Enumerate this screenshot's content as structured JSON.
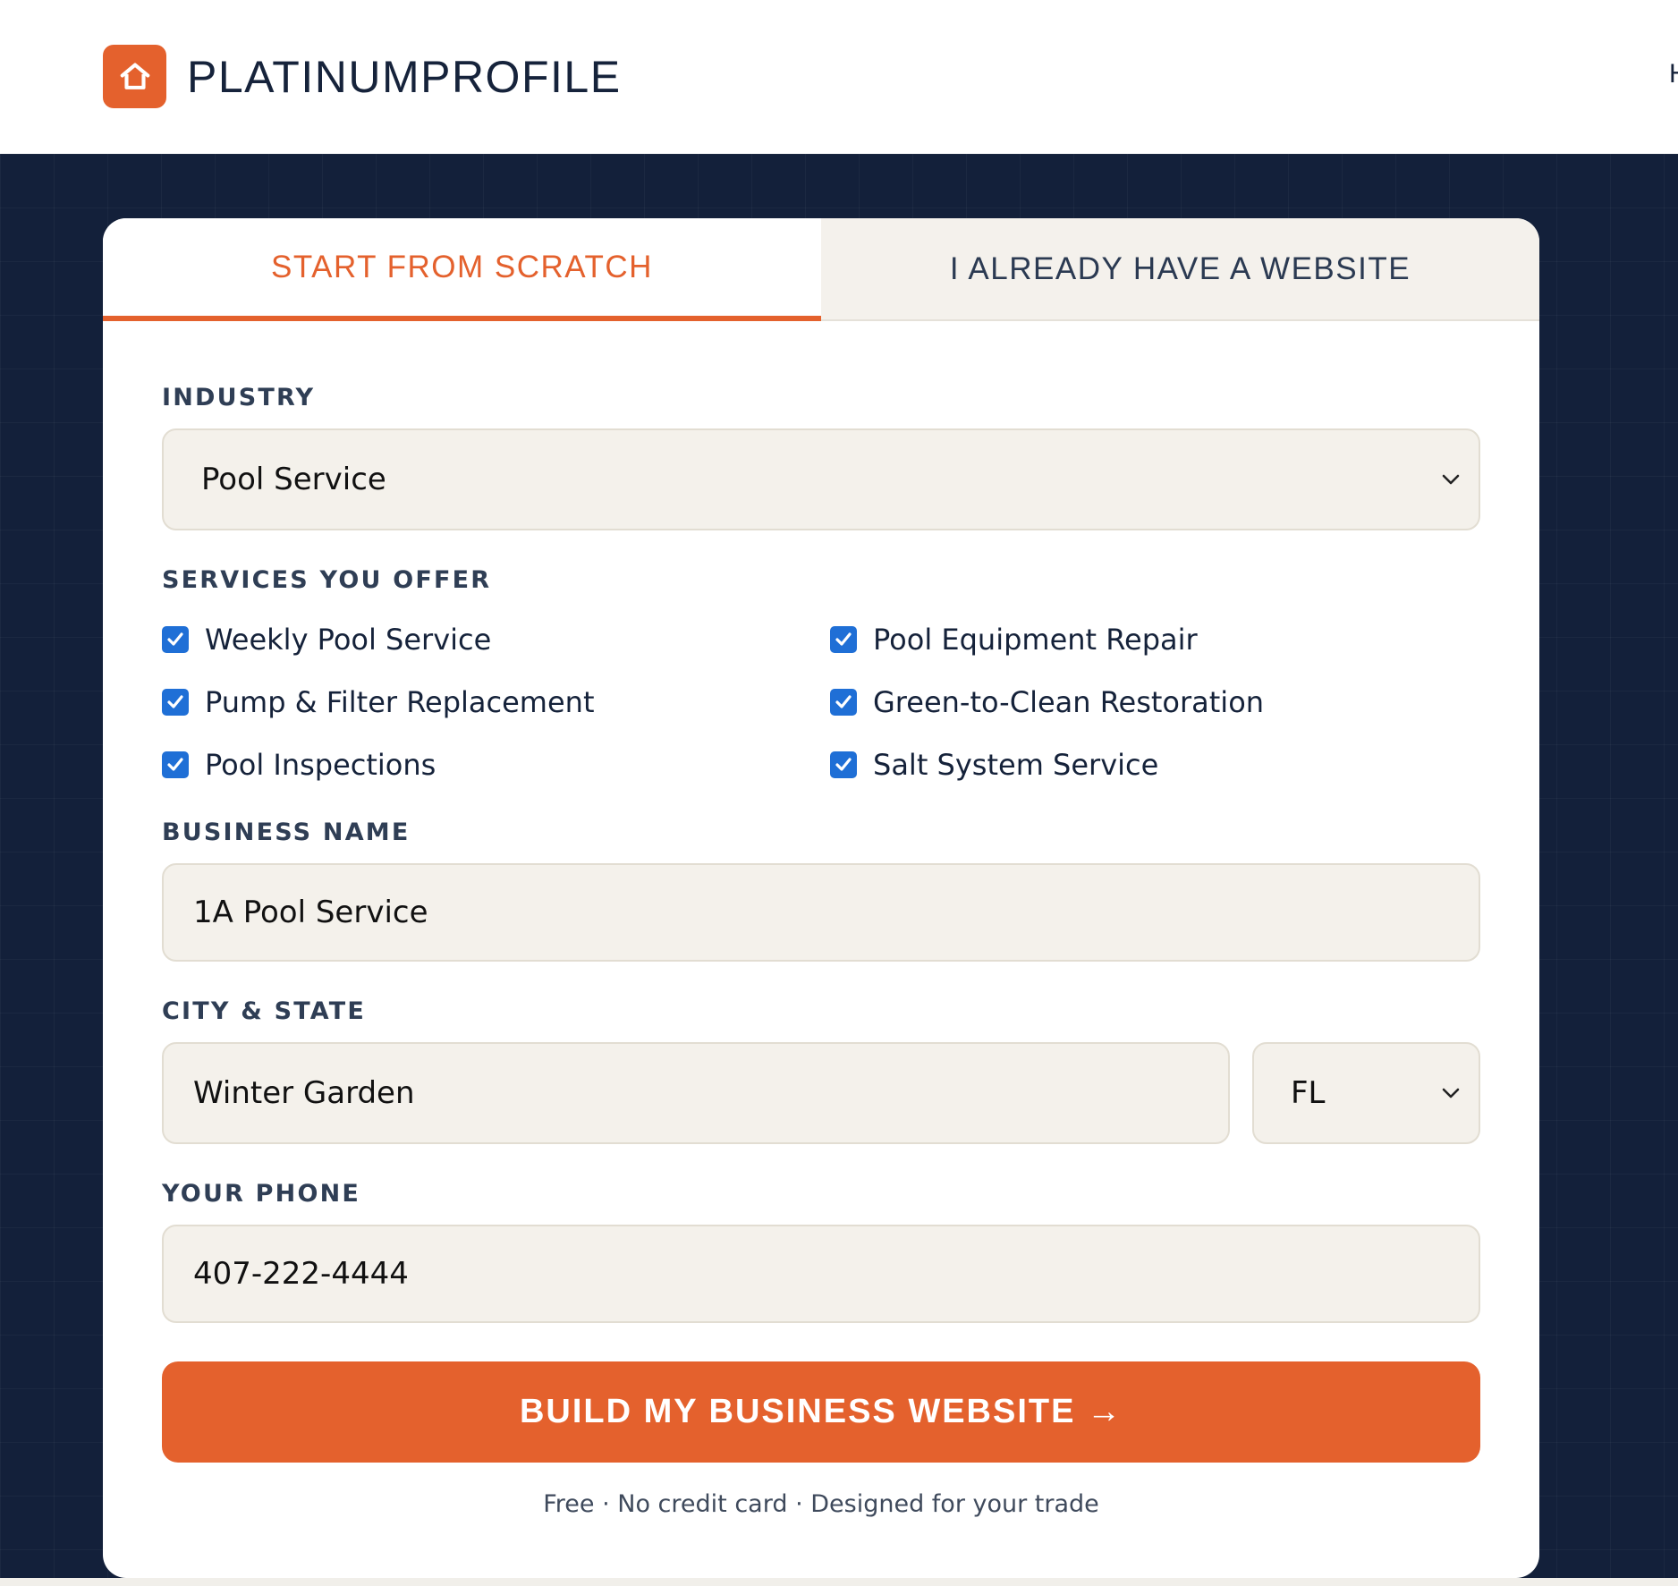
{
  "header": {
    "brand": "PLATINUMPROFILE",
    "logo_icon": "home-icon",
    "nav_peek": "H"
  },
  "tabs": [
    {
      "label": "START FROM SCRATCH",
      "active": true
    },
    {
      "label": "I ALREADY HAVE A WEBSITE",
      "active": false
    }
  ],
  "form": {
    "industry": {
      "label": "INDUSTRY",
      "value": "Pool Service"
    },
    "services": {
      "label": "SERVICES YOU OFFER",
      "items": [
        {
          "label": "Weekly Pool Service",
          "checked": true
        },
        {
          "label": "Pool Equipment Repair",
          "checked": true
        },
        {
          "label": "Pump & Filter Replacement",
          "checked": true
        },
        {
          "label": "Green-to-Clean Restoration",
          "checked": true
        },
        {
          "label": "Pool Inspections",
          "checked": true
        },
        {
          "label": "Salt System Service",
          "checked": true
        }
      ]
    },
    "business_name": {
      "label": "BUSINESS NAME",
      "value": "1A Pool Service"
    },
    "city_state": {
      "label": "CITY & STATE",
      "city": "Winter Garden",
      "state": "FL"
    },
    "phone": {
      "label": "YOUR PHONE",
      "value": "407-222-4444"
    },
    "submit_label": "BUILD MY BUSINESS WEBSITE →",
    "footnote": "Free · No credit card · Designed for your trade"
  },
  "colors": {
    "accent": "#e4612d",
    "navy": "#13203a",
    "field_bg": "#f4f1eb",
    "checkbox": "#1f6fd6"
  }
}
